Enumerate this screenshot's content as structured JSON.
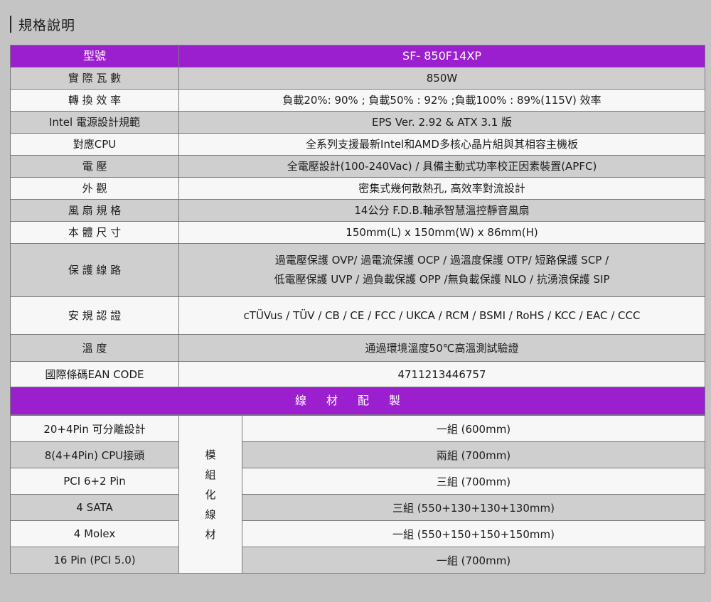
{
  "section_title": "規格說明",
  "spec_header": {
    "label": "型號",
    "value": "SF- 850F14XP"
  },
  "spec_rows": [
    {
      "label": "實 際 瓦 數",
      "value": "850W"
    },
    {
      "label": "轉 換 效 率",
      "value": "負載20%: 90% ; 負載50% : 92% ;負載100% : 89%(115V) 效率"
    },
    {
      "label": "Intel 電源設計規範",
      "value": "EPS Ver. 2.92 & ATX 3.1 版"
    },
    {
      "label": "對應CPU",
      "value": "全系列支援最新Intel和AMD多核心晶片組與其相容主機板"
    },
    {
      "label": "電 壓",
      "value": "全電壓設計(100-240Vac) / 具備主動式功率校正因素裝置(APFC)"
    },
    {
      "label": "外 觀",
      "value": "密集式幾何散熱孔, 高效率對流設計"
    },
    {
      "label": "風 扇 規 格",
      "value": "14公分 F.D.B.軸承智慧溫控靜音風扇"
    },
    {
      "label": "本 體 尺 寸",
      "value": "150mm(L) x 150mm(W) x 86mm(H)"
    },
    {
      "label": "保 護 線 路",
      "value_line1": "過電壓保護 OVP/ 過電流保護 OCP / 過溫度保護 OTP/ 短路保護 SCP /",
      "value_line2": "低電壓保護 UVP / 過負載保護 OPP /無負載保護 NLO / 抗湧浪保護 SIP"
    },
    {
      "label": "安 規 認 證",
      "value": "cTÜVus / TÜV / CB / CE / FCC / UKCA / RCM / BSMI / RoHS / KCC / EAC / CCC"
    },
    {
      "label": "溫 度",
      "value": "通過環境溫度50℃高溫測試驗證"
    },
    {
      "label": "國際條碼EAN CODE",
      "value": "4711213446757"
    }
  ],
  "cable_header": "線材配製",
  "cable_group_label": "模組化線材",
  "cable_rows": [
    {
      "connector": "20+4Pin 可分離設計",
      "spec": "一組 (600mm)"
    },
    {
      "connector": "8(4+4Pin) CPU接頭",
      "spec": "兩組 (700mm)"
    },
    {
      "connector": "PCI 6+2 Pin",
      "spec": "三組 (700mm)"
    },
    {
      "connector": "4 SATA",
      "spec": "三組 (550+130+130+130mm)"
    },
    {
      "connector": "4 Molex",
      "spec": "一組 (550+150+150+150mm)"
    },
    {
      "connector": "16 Pin (PCI 5.0)",
      "spec": "一組 (700mm)"
    }
  ]
}
